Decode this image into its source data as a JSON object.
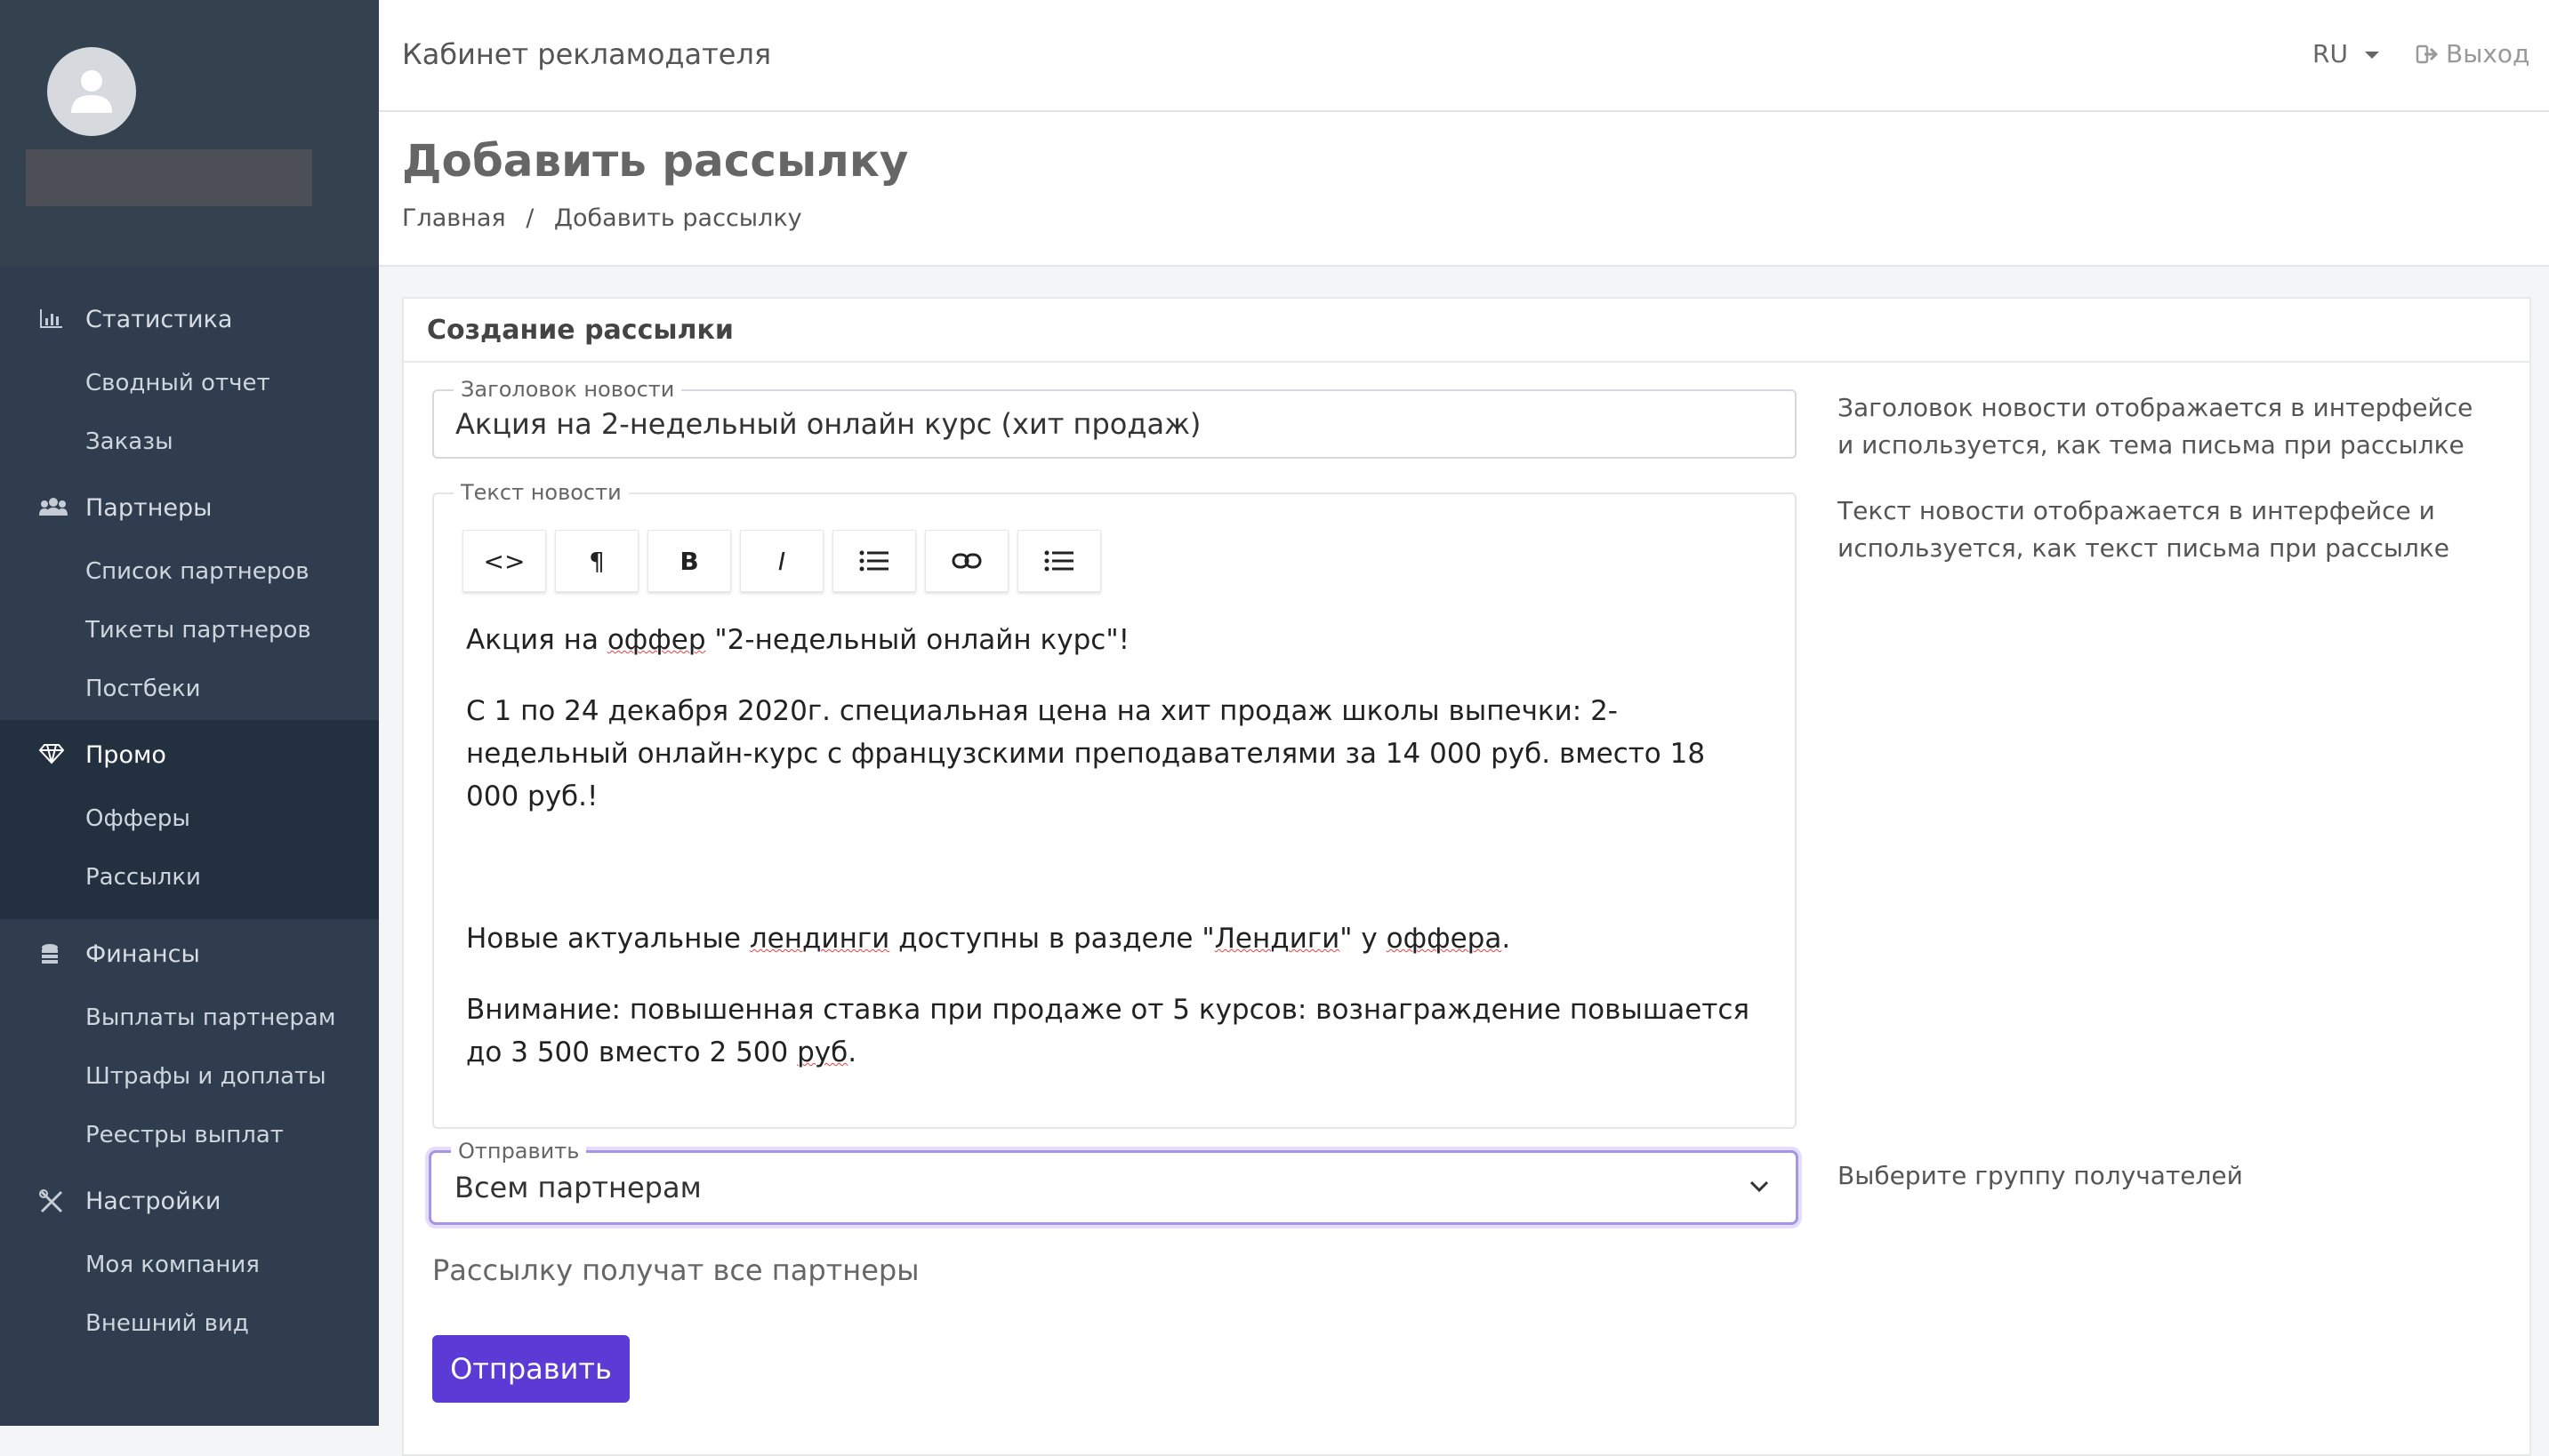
{
  "app_title": "Кабинет рекламодателя",
  "topbar": {
    "lang": "RU",
    "logout": "Выход"
  },
  "page": {
    "title": "Добавить рассылку",
    "breadcrumb": [
      "Главная",
      "Добавить рассылку"
    ],
    "breadcrumb_sep": "/"
  },
  "sidebar": {
    "sections": [
      {
        "label": "Статистика",
        "icon": "bar-chart-icon",
        "items": [
          "Сводный отчет",
          "Заказы"
        ]
      },
      {
        "label": "Партнеры",
        "icon": "users-icon",
        "items": [
          "Список партнеров",
          "Тикеты партнеров",
          "Постбеки"
        ]
      },
      {
        "label": "Промо",
        "icon": "diamond-icon",
        "items": [
          "Офферы",
          "Рассылки"
        ]
      },
      {
        "label": "Финансы",
        "icon": "coins-icon",
        "items": [
          "Выплаты партнерам",
          "Штрафы и доплаты",
          "Реестры выплат"
        ]
      },
      {
        "label": "Настройки",
        "icon": "tools-icon",
        "items": [
          "Моя компания",
          "Внешний вид"
        ]
      }
    ]
  },
  "form": {
    "card_title": "Создание рассылки",
    "title_field": {
      "label": "Заголовок новости",
      "value": "Акция на 2-недельный онлайн курс (хит продаж)"
    },
    "title_hint": "Заголовок новости отображается в интерфейсе и используется, как тема письма при рассылке",
    "text_field": {
      "label": "Текст новости"
    },
    "text_hint": "Текст новости отображается в интерфейсе и используется, как текст письма при рассылке",
    "toolbar": [
      "<>",
      "¶",
      "B",
      "I",
      "list",
      "link",
      "list2"
    ],
    "editor": {
      "p1a": "Акция на ",
      "p1w": "оффер",
      "p1b": " \"2-недельный онлайн курс\"!",
      "p2": "С 1 по 24 декабря 2020г. специальная цена на хит продаж школы выпечки: 2-недельный онлайн-курс с французскими преподавателями за 14 000 руб. вместо 18 000 руб.!",
      "p3a": "Новые актуальные ",
      "p3w1": "лендинги",
      "p3b": " доступны в разделе \"",
      "p3w2": "Лендиги",
      "p3c": "\" у ",
      "p3w3": "оффера",
      "p3d": ".",
      "p4a": "Внимание: повышенная ставка при продаже от 5 курсов: вознаграждение повышается до 3 500 вместо 2 500 ",
      "p4w": "руб",
      "p4b": "."
    },
    "send_field": {
      "label": "Отправить",
      "value": "Всем партнерам"
    },
    "send_hint": "Выберите группу получателей",
    "info": "Рассылку получат все партнеры",
    "submit": "Отправить"
  }
}
